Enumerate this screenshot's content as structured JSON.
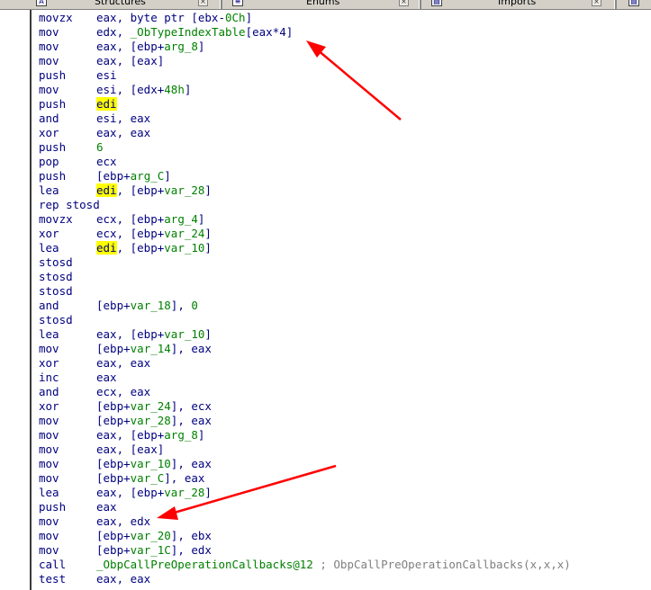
{
  "tabs": [
    {
      "label": "Structures",
      "icon": "structure-icon"
    },
    {
      "label": "Enums",
      "icon": "enum-icon"
    },
    {
      "label": "Imports",
      "icon": "imports-icon"
    }
  ],
  "highlight_register": "edi",
  "colors": {
    "text": "#000080",
    "name": "#008000",
    "highlight": "#ffff00",
    "comment": "#808080",
    "arrow": "#ff0000"
  },
  "disassembly": [
    {
      "mn": "movzx",
      "ops": [
        {
          "t": "eax, byte ptr [ebx-"
        },
        {
          "t": "0Ch",
          "c": "num"
        },
        {
          "t": "]"
        }
      ]
    },
    {
      "mn": "mov",
      "ops": [
        {
          "t": "edx, "
        },
        {
          "t": "_ObTypeIndexTable",
          "c": "vr"
        },
        {
          "t": "[eax*4]"
        }
      ]
    },
    {
      "mn": "mov",
      "ops": [
        {
          "t": "eax, [ebp+"
        },
        {
          "t": "arg_8",
          "c": "vr"
        },
        {
          "t": "]"
        }
      ]
    },
    {
      "mn": "mov",
      "ops": [
        {
          "t": "eax, [eax]"
        }
      ]
    },
    {
      "mn": "push",
      "ops": [
        {
          "t": "esi"
        }
      ]
    },
    {
      "mn": "mov",
      "ops": [
        {
          "t": "esi, [edx+"
        },
        {
          "t": "48h",
          "c": "num"
        },
        {
          "t": "]"
        }
      ]
    },
    {
      "mn": "push",
      "ops": [
        {
          "t": "edi",
          "c": "hl"
        }
      ]
    },
    {
      "mn": "and",
      "ops": [
        {
          "t": "esi, eax"
        }
      ]
    },
    {
      "mn": "xor",
      "ops": [
        {
          "t": "eax, eax"
        }
      ]
    },
    {
      "mn": "push",
      "ops": [
        {
          "t": "6",
          "c": "num"
        }
      ]
    },
    {
      "mn": "pop",
      "ops": [
        {
          "t": "ecx"
        }
      ]
    },
    {
      "mn": "push",
      "ops": [
        {
          "t": "[ebp+"
        },
        {
          "t": "arg_C",
          "c": "vr"
        },
        {
          "t": "]"
        }
      ]
    },
    {
      "mn": "lea",
      "ops": [
        {
          "t": "edi",
          "c": "hl"
        },
        {
          "t": ", [ebp+"
        },
        {
          "t": "var_28",
          "c": "vr"
        },
        {
          "t": "]"
        }
      ]
    },
    {
      "mn": "rep stosd",
      "ops": []
    },
    {
      "mn": "movzx",
      "ops": [
        {
          "t": "ecx, [ebp+"
        },
        {
          "t": "arg_4",
          "c": "vr"
        },
        {
          "t": "]"
        }
      ]
    },
    {
      "mn": "xor",
      "ops": [
        {
          "t": "ecx, [ebp+"
        },
        {
          "t": "var_24",
          "c": "vr"
        },
        {
          "t": "]"
        }
      ]
    },
    {
      "mn": "lea",
      "ops": [
        {
          "t": "edi",
          "c": "hl"
        },
        {
          "t": ", [ebp+"
        },
        {
          "t": "var_10",
          "c": "vr"
        },
        {
          "t": "]"
        }
      ]
    },
    {
      "mn": "stosd",
      "ops": []
    },
    {
      "mn": "stosd",
      "ops": []
    },
    {
      "mn": "stosd",
      "ops": []
    },
    {
      "mn": "and",
      "ops": [
        {
          "t": "[ebp+"
        },
        {
          "t": "var_18",
          "c": "vr"
        },
        {
          "t": "], "
        },
        {
          "t": "0",
          "c": "num"
        }
      ]
    },
    {
      "mn": "stosd",
      "ops": []
    },
    {
      "mn": "lea",
      "ops": [
        {
          "t": "eax, [ebp+"
        },
        {
          "t": "var_10",
          "c": "vr"
        },
        {
          "t": "]"
        }
      ]
    },
    {
      "mn": "mov",
      "ops": [
        {
          "t": "[ebp+"
        },
        {
          "t": "var_14",
          "c": "vr"
        },
        {
          "t": "], eax"
        }
      ]
    },
    {
      "mn": "xor",
      "ops": [
        {
          "t": "eax, eax"
        }
      ]
    },
    {
      "mn": "inc",
      "ops": [
        {
          "t": "eax"
        }
      ]
    },
    {
      "mn": "and",
      "ops": [
        {
          "t": "ecx, eax"
        }
      ]
    },
    {
      "mn": "xor",
      "ops": [
        {
          "t": "[ebp+"
        },
        {
          "t": "var_24",
          "c": "vr"
        },
        {
          "t": "], ecx"
        }
      ]
    },
    {
      "mn": "mov",
      "ops": [
        {
          "t": "[ebp+"
        },
        {
          "t": "var_28",
          "c": "vr"
        },
        {
          "t": "], eax"
        }
      ]
    },
    {
      "mn": "mov",
      "ops": [
        {
          "t": "eax, [ebp+"
        },
        {
          "t": "arg_8",
          "c": "vr"
        },
        {
          "t": "]"
        }
      ]
    },
    {
      "mn": "mov",
      "ops": [
        {
          "t": "eax, [eax]"
        }
      ]
    },
    {
      "mn": "mov",
      "ops": [
        {
          "t": "[ebp+"
        },
        {
          "t": "var_10",
          "c": "vr"
        },
        {
          "t": "], eax"
        }
      ]
    },
    {
      "mn": "mov",
      "ops": [
        {
          "t": "[ebp+"
        },
        {
          "t": "var_C",
          "c": "vr"
        },
        {
          "t": "], eax"
        }
      ]
    },
    {
      "mn": "lea",
      "ops": [
        {
          "t": "eax, [ebp+"
        },
        {
          "t": "var_28",
          "c": "vr"
        },
        {
          "t": "]"
        }
      ]
    },
    {
      "mn": "push",
      "ops": [
        {
          "t": "eax"
        }
      ]
    },
    {
      "mn": "mov",
      "ops": [
        {
          "t": "eax, edx"
        }
      ]
    },
    {
      "mn": "mov",
      "ops": [
        {
          "t": "[ebp+"
        },
        {
          "t": "var_20",
          "c": "vr"
        },
        {
          "t": "], ebx"
        }
      ]
    },
    {
      "mn": "mov",
      "ops": [
        {
          "t": "[ebp+"
        },
        {
          "t": "var_1C",
          "c": "vr"
        },
        {
          "t": "], edx"
        }
      ]
    },
    {
      "mn": "call",
      "ops": [
        {
          "t": "_ObpCallPreOperationCallbacks@12",
          "c": "vr"
        },
        {
          "t": " ; ObpCallPreOperationCallbacks(x,x,x)",
          "c": "cmt"
        }
      ]
    },
    {
      "mn": "test",
      "ops": [
        {
          "t": "eax, eax"
        }
      ]
    }
  ]
}
